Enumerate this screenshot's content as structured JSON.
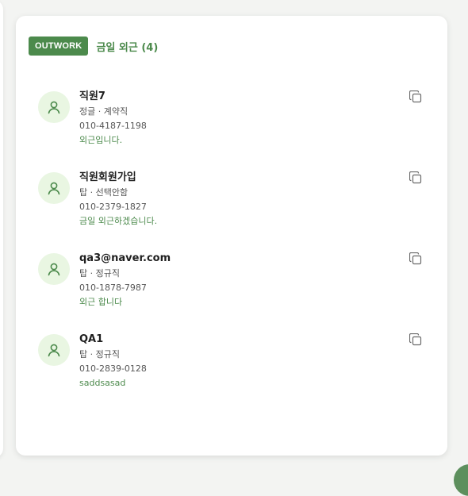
{
  "header": {
    "badge": "OUTWORK",
    "title": "금일 외근 (4)"
  },
  "employees": [
    {
      "name": "직원7",
      "dept": "정글 · 계약직",
      "phone": "010-4187-1198",
      "message": "외근입니다."
    },
    {
      "name": "직원회원가입",
      "dept": "탑 · 선택안함",
      "phone": "010-2379-1827",
      "message": "금일 외근하겠습니다."
    },
    {
      "name": "qa3@naver.com",
      "dept": "탑 · 정규직",
      "phone": "010-1878-7987",
      "message": "외근 합니다"
    },
    {
      "name": "QA1",
      "dept": "탑 · 정규직",
      "phone": "010-2839-0128",
      "message": "saddsasad"
    }
  ],
  "icons": {
    "avatar": "user-icon",
    "copy": "copy-icon"
  },
  "colors": {
    "accent": "#4c8a4c",
    "avatar_bg": "#e9f6e2",
    "text": "#1f1f1f",
    "muted": "#555555"
  }
}
